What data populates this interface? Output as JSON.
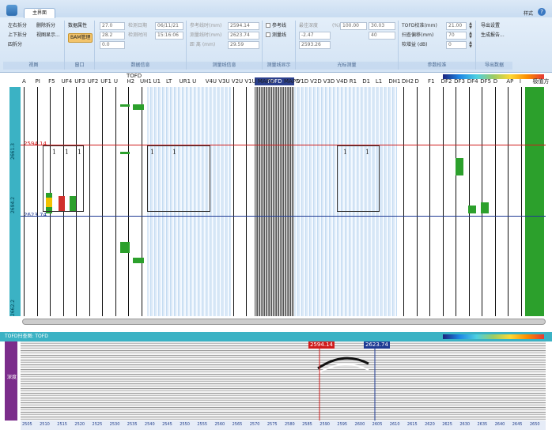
{
  "ribbon": {
    "tab": "主界面",
    "style_menu": "样式",
    "view_group": {
      "label": "视图",
      "items": [
        "左右拆分",
        "删除拆分",
        "上下拆分",
        "视图显示...",
        "四拆分"
      ]
    },
    "window_group": {
      "label": "窗口",
      "items": [
        "数据属性",
        "BAM管理"
      ]
    },
    "data_info": {
      "label": "数据信息",
      "v1": "27.0",
      "v2": "28.2",
      "v3": "0.0",
      "date_label": "检测日期",
      "date": "06/11/21",
      "time_label": "检测时间",
      "time": "15:16:06"
    },
    "measure_info": {
      "label": "测量线信息",
      "ref_label": "参考线时(mm)",
      "ref": "2594.14",
      "meas_label": "测量线时(mm)",
      "meas": "2623.74",
      "dist_label": "距  离 (mm)",
      "dist": "29.59"
    },
    "measure_show": {
      "label": "测量线显示",
      "ref_check": "参考线",
      "meas_check": "测量线"
    },
    "cursor": {
      "label": "光标测量",
      "depth_label": "最佳深度",
      "pct_label": "(%)",
      "pct": "100.00",
      "v1": "30.03",
      "v2": "-2.47",
      "v3": "40",
      "v4": "2593.26"
    },
    "params": {
      "label": "参数校准",
      "tofd_label": "TOFD校准(mm)",
      "tofd": "21.00",
      "scan_label": "扫查偏移(mm)",
      "scan": "70",
      "gain_label": "软增益 (dB)",
      "gain": "0"
    },
    "export": {
      "label": "导出数据",
      "settings": "导出设置",
      "report": "生成报告..."
    }
  },
  "main": {
    "tofd_top": "TOFD",
    "headers": [
      "A",
      "PI",
      "F5",
      "UF4",
      "UF3",
      "UF2",
      "UF1",
      "U",
      "H2",
      "UH1",
      "U1",
      "LT",
      "UR1",
      "U",
      "V4U",
      "V3U",
      "V2U",
      "V1U",
      "MAPU",
      "TOFD",
      "MAPD",
      "V1D",
      "V2D",
      "V3D",
      "V4D",
      "R1",
      "D1",
      "L1",
      "DH1",
      "DH2",
      "D",
      "F1",
      "DF2",
      "DF3",
      "DF4",
      "DF5",
      "D",
      "AP",
      "I",
      "极值方"
    ],
    "ref_value": "2594.14",
    "meas_value": "2623.74",
    "ruler_labels": [
      "2661.3",
      "2694.2",
      "2662.2",
      "2662.2",
      "2662.2"
    ],
    "ones": [
      "1",
      "1",
      "1",
      "1",
      "1",
      "1",
      "1"
    ]
  },
  "bottom": {
    "title": "TOFD扫查图: TOFD",
    "ref_marker": "2594.14",
    "meas_marker": "2623.74",
    "side_label": "深度",
    "axis_labels": [
      "2505",
      "2510",
      "2515",
      "2520",
      "2525",
      "2530",
      "2535",
      "2540",
      "2545",
      "2550",
      "2555",
      "2560",
      "2565",
      "2570",
      "2575",
      "2580",
      "2585",
      "2590",
      "2595",
      "2600",
      "2605",
      "2610",
      "2615",
      "2620",
      "2625",
      "2630",
      "2635",
      "2640",
      "2645",
      "2650"
    ]
  },
  "colors": {
    "ref_line": "#d01c1c",
    "meas_line": "#1f3a93",
    "accent": "#3bb2c4",
    "green_mark": "#2ca02c"
  }
}
